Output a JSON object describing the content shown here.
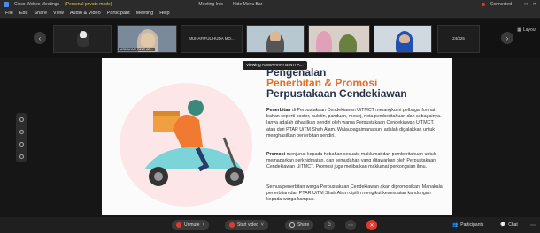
{
  "titlebar": {
    "app_title": "Cisco Webex Meetings",
    "warning": "(Personal private mode)",
    "meeting_info": "Meeting Info",
    "host": "Hide Menu Bar",
    "connected": "Connected"
  },
  "menu": [
    "File",
    "Edit",
    "Share",
    "View",
    "Audio & Video",
    "Participant",
    "Meeting",
    "Help"
  ],
  "participants": [
    {
      "label": "ASMAHANI BINTI AB..."
    },
    {
      "label": "MUHAFIFUL HUDA MO..."
    },
    {
      "label": ""
    },
    {
      "label": ""
    },
    {
      "label": ""
    }
  ],
  "center_tile_text": "MUHAFIFUL HUDA MO...",
  "count_tile_text": "24/325",
  "layout_label": "Layout",
  "viewing_label": "Viewing ASMAHANI BINTI A...",
  "slide": {
    "title_line1": "Pengenalan",
    "title_line2": "Penerbitan & Promosi",
    "title_line3": "Perpustakaan Cendekiawan",
    "para1_bold": "Penerbitan",
    "para1": " di Perpustakaan Cendekiawan UiTMCT merangkumi pelbagai format bahan seperti poster, buletin, panduan, mesej, nota pemberitahuan dan sebagainya. Ianya adalah dihasilkan sendiri oleh warga Perpustakaan Cendekiawan UiTMCT, atau dari PTAR UiTM Shah Alam. Walaubagaimanapun, adalah digalakkan untuk menghasilkan penerbitan sendiri.",
    "para2_bold": "Promosi",
    "para2": " menjurus kepada hebahan sesuatu maklumat dan pemberitahuan untuk memaparkan perkhidmatan, dan kemudahan yang ditawarkan oleh Perpustakaan Cendekiawan UiTMCT. Promosi juga melibatkan maklumat perkongsian ilmu.",
    "para3": "Semua penerbitan warga Perpustakaan Cendekiawan akan dipromosikan. Manakala penerbitan dari PTAR UiTM Shah Alam dipilih mengikut kesesuaian kandungan kepada warga kampus."
  },
  "toolbar": {
    "unmute": "Unmute",
    "start_video": "Start video",
    "share": "Share",
    "participants": "Participants",
    "chat": "Chat"
  },
  "colors": {
    "accent": "#e76f24",
    "navy": "#28324a",
    "end": "#e03a2f"
  }
}
